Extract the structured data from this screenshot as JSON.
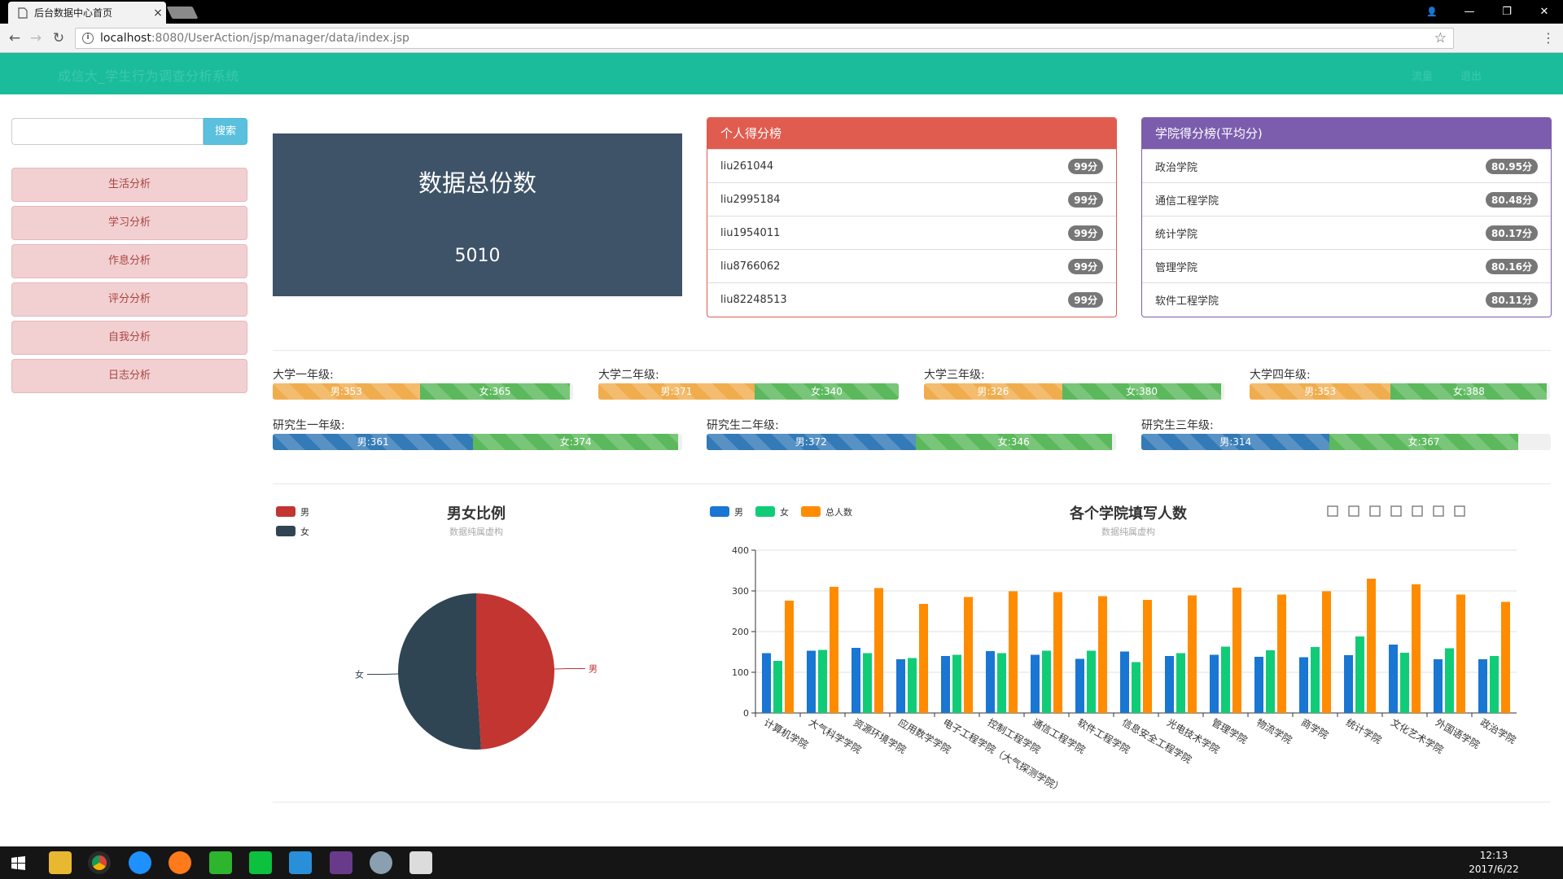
{
  "browser": {
    "tab_title": "后台数据中心首页",
    "tab_close": "×",
    "url_host": "localhost",
    "url_rest": ":8080/UserAction/jsp/manager/data/index.jsp",
    "star": "☆",
    "kebab": "⋮",
    "win_user": "👤",
    "win_min": "—",
    "win_max": "❐",
    "win_close": "✕"
  },
  "header": {
    "brand": "成信大_学生行为调查分析系统",
    "nav_home": "流量",
    "nav_logout": "退出"
  },
  "sidebar": {
    "search_button": "搜索",
    "items": [
      {
        "label": "生活分析"
      },
      {
        "label": "学习分析"
      },
      {
        "label": "作息分析"
      },
      {
        "label": "评分分析"
      },
      {
        "label": "自我分析"
      },
      {
        "label": "日志分析"
      }
    ]
  },
  "summary": {
    "title": "数据总份数",
    "value": "5010"
  },
  "personal_rank": {
    "title": "个人得分榜",
    "color": "#e05c4f",
    "rows": [
      {
        "name": "liu261044",
        "score": "99分"
      },
      {
        "name": "liu2995184",
        "score": "99分"
      },
      {
        "name": "liu1954011",
        "score": "99分"
      },
      {
        "name": "liu8766062",
        "score": "99分"
      },
      {
        "name": "liu82248513",
        "score": "99分"
      }
    ]
  },
  "college_rank": {
    "title": "学院得分榜(平均分)",
    "color": "#7b5cad",
    "rows": [
      {
        "name": "政治学院",
        "score": "80.95分"
      },
      {
        "name": "通信工程学院",
        "score": "80.48分"
      },
      {
        "name": "统计学院",
        "score": "80.17分"
      },
      {
        "name": "管理学院",
        "score": "80.16分"
      },
      {
        "name": "软件工程学院",
        "score": "80.11分"
      }
    ]
  },
  "grades": [
    {
      "label": "大学一年级:",
      "male": "男:353",
      "female": "女:365",
      "male_pct": 49,
      "female_pct": 50,
      "male_color": "#f0ad4e"
    },
    {
      "label": "大学二年级:",
      "male": "男:371",
      "female": "女:340",
      "male_pct": 52,
      "female_pct": 48,
      "male_color": "#f0ad4e"
    },
    {
      "label": "大学三年级:",
      "male": "男:326",
      "female": "女:380",
      "male_pct": 46,
      "female_pct": 53,
      "male_color": "#f0ad4e"
    },
    {
      "label": "大学四年级:",
      "male": "男:353",
      "female": "女:388",
      "male_pct": 47,
      "female_pct": 52,
      "male_color": "#f0ad4e"
    },
    {
      "label": "研究生一年级:",
      "male": "男:361",
      "female": "女:374",
      "male_pct": 49,
      "female_pct": 50,
      "male_color": "#337ab7"
    },
    {
      "label": "研究生二年级:",
      "male": "男:372",
      "female": "女:346",
      "male_pct": 51,
      "female_pct": 48,
      "male_color": "#337ab7"
    },
    {
      "label": "研究生三年级:",
      "male": "男:314",
      "female": "女:367",
      "male_pct": 46,
      "female_pct": 46,
      "male_color": "#337ab7"
    }
  ],
  "chart_data": [
    {
      "type": "pie",
      "title": "男女比例",
      "subtitle": "数据纯属虚构",
      "legend": [
        "男",
        "女"
      ],
      "legend_position": "top-left",
      "slices": [
        {
          "label": "男",
          "value": 49,
          "color": "#c23531"
        },
        {
          "label": "女",
          "value": 51,
          "color": "#2f4554"
        }
      ]
    },
    {
      "type": "bar",
      "title": "各个学院填写人数",
      "subtitle": "数据纯属虚构",
      "legend_position": "top-left",
      "ylim": [
        0,
        400
      ],
      "yticks": [
        0,
        100,
        200,
        300,
        400
      ],
      "grid": true,
      "categories": [
        "计算机学院",
        "大气科学学院",
        "资源环境学院",
        "应用数学学院",
        "电子工程学院（大气探测学院）",
        "控制工程学院",
        "通信工程学院",
        "软件工程学院",
        "信息安全工程学院",
        "光电技术学院",
        "管理学院",
        "物流学院",
        "商学院",
        "统计学院",
        "文化艺术学院",
        "外国语学院",
        "政治学院"
      ],
      "series": [
        {
          "name": "男",
          "color": "#1976d2",
          "values": [
            147,
            153,
            160,
            132,
            140,
            152,
            143,
            133,
            151,
            140,
            143,
            138,
            137,
            142,
            168,
            132,
            132
          ]
        },
        {
          "name": "女",
          "color": "#11cc77",
          "values": [
            128,
            155,
            147,
            135,
            143,
            147,
            153,
            153,
            125,
            147,
            163,
            154,
            162,
            188,
            148,
            159,
            140
          ]
        },
        {
          "name": "总人数",
          "color": "#ff8c00",
          "values": [
            276,
            310,
            307,
            268,
            285,
            299,
            297,
            287,
            278,
            289,
            308,
            291,
            299,
            330,
            316,
            291,
            273
          ]
        }
      ]
    }
  ]
}
